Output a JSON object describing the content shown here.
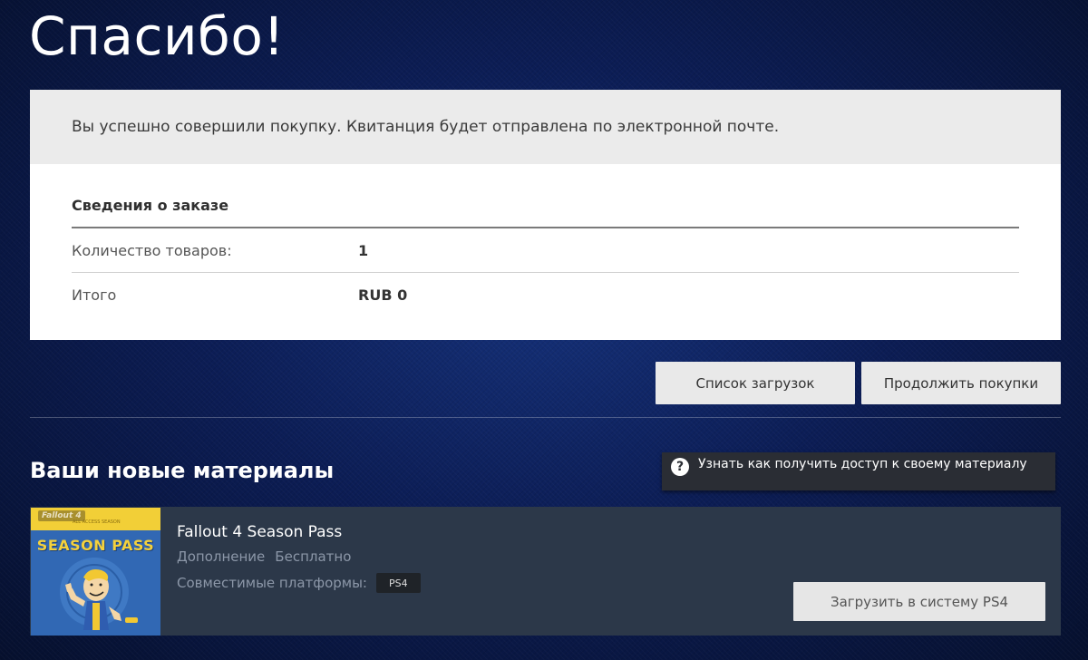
{
  "page": {
    "title": "Спасибо!"
  },
  "confirmation": {
    "message": "Вы успешно совершили покупку. Квитанция будет отправлена по электронной почте."
  },
  "order": {
    "heading": "Сведения о заказе",
    "rows": [
      {
        "label": "Количество товаров:",
        "value": "1"
      },
      {
        "label": "Итого",
        "value": "RUB 0"
      }
    ]
  },
  "actions": {
    "downloads_label": "Список загрузок",
    "continue_label": "Продолжить покупки"
  },
  "materials": {
    "heading": "Ваши новые материалы",
    "help_label": "Узнать как получить доступ к своему материалу",
    "help_icon": "question-circle-icon"
  },
  "product": {
    "name": "Fallout 4 Season Pass",
    "type": "Дополнение",
    "price": "Бесплатно",
    "platforms_label": "Совместимые платформы:",
    "platform": "PS4",
    "install_label": "Загрузить в систему PS4",
    "thumbnail": {
      "logo": "Fallout 4",
      "subtitle": "ALL ACCESS SEASON",
      "title": "SEASON PASS"
    }
  },
  "colors": {
    "background": "#0c1d55",
    "card": "#ffffff",
    "banner": "#ebebeb",
    "product_panel": "#2c3849",
    "button": "#e9e9e9",
    "thumb_yellow": "#f2cf37",
    "thumb_blue": "#3168b4"
  }
}
